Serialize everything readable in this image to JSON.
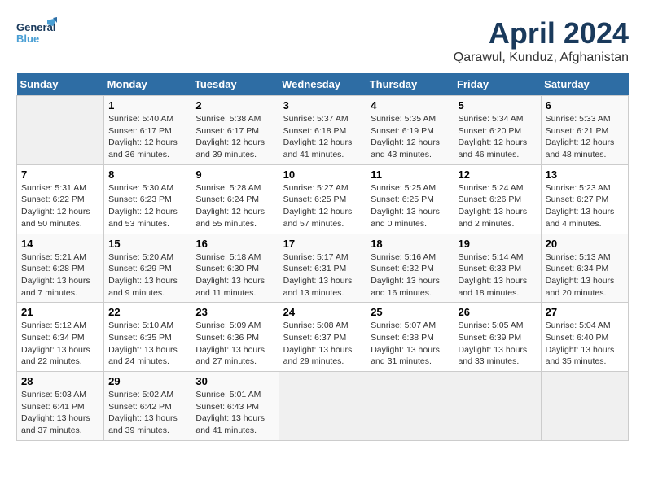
{
  "header": {
    "logo_general": "General",
    "logo_blue": "Blue",
    "month_title": "April 2024",
    "location": "Qarawul, Kunduz, Afghanistan"
  },
  "weekdays": [
    "Sunday",
    "Monday",
    "Tuesday",
    "Wednesday",
    "Thursday",
    "Friday",
    "Saturday"
  ],
  "weeks": [
    [
      {
        "day": "",
        "info": ""
      },
      {
        "day": "1",
        "info": "Sunrise: 5:40 AM\nSunset: 6:17 PM\nDaylight: 12 hours\nand 36 minutes."
      },
      {
        "day": "2",
        "info": "Sunrise: 5:38 AM\nSunset: 6:17 PM\nDaylight: 12 hours\nand 39 minutes."
      },
      {
        "day": "3",
        "info": "Sunrise: 5:37 AM\nSunset: 6:18 PM\nDaylight: 12 hours\nand 41 minutes."
      },
      {
        "day": "4",
        "info": "Sunrise: 5:35 AM\nSunset: 6:19 PM\nDaylight: 12 hours\nand 43 minutes."
      },
      {
        "day": "5",
        "info": "Sunrise: 5:34 AM\nSunset: 6:20 PM\nDaylight: 12 hours\nand 46 minutes."
      },
      {
        "day": "6",
        "info": "Sunrise: 5:33 AM\nSunset: 6:21 PM\nDaylight: 12 hours\nand 48 minutes."
      }
    ],
    [
      {
        "day": "7",
        "info": "Sunrise: 5:31 AM\nSunset: 6:22 PM\nDaylight: 12 hours\nand 50 minutes."
      },
      {
        "day": "8",
        "info": "Sunrise: 5:30 AM\nSunset: 6:23 PM\nDaylight: 12 hours\nand 53 minutes."
      },
      {
        "day": "9",
        "info": "Sunrise: 5:28 AM\nSunset: 6:24 PM\nDaylight: 12 hours\nand 55 minutes."
      },
      {
        "day": "10",
        "info": "Sunrise: 5:27 AM\nSunset: 6:25 PM\nDaylight: 12 hours\nand 57 minutes."
      },
      {
        "day": "11",
        "info": "Sunrise: 5:25 AM\nSunset: 6:25 PM\nDaylight: 13 hours\nand 0 minutes."
      },
      {
        "day": "12",
        "info": "Sunrise: 5:24 AM\nSunset: 6:26 PM\nDaylight: 13 hours\nand 2 minutes."
      },
      {
        "day": "13",
        "info": "Sunrise: 5:23 AM\nSunset: 6:27 PM\nDaylight: 13 hours\nand 4 minutes."
      }
    ],
    [
      {
        "day": "14",
        "info": "Sunrise: 5:21 AM\nSunset: 6:28 PM\nDaylight: 13 hours\nand 7 minutes."
      },
      {
        "day": "15",
        "info": "Sunrise: 5:20 AM\nSunset: 6:29 PM\nDaylight: 13 hours\nand 9 minutes."
      },
      {
        "day": "16",
        "info": "Sunrise: 5:18 AM\nSunset: 6:30 PM\nDaylight: 13 hours\nand 11 minutes."
      },
      {
        "day": "17",
        "info": "Sunrise: 5:17 AM\nSunset: 6:31 PM\nDaylight: 13 hours\nand 13 minutes."
      },
      {
        "day": "18",
        "info": "Sunrise: 5:16 AM\nSunset: 6:32 PM\nDaylight: 13 hours\nand 16 minutes."
      },
      {
        "day": "19",
        "info": "Sunrise: 5:14 AM\nSunset: 6:33 PM\nDaylight: 13 hours\nand 18 minutes."
      },
      {
        "day": "20",
        "info": "Sunrise: 5:13 AM\nSunset: 6:34 PM\nDaylight: 13 hours\nand 20 minutes."
      }
    ],
    [
      {
        "day": "21",
        "info": "Sunrise: 5:12 AM\nSunset: 6:34 PM\nDaylight: 13 hours\nand 22 minutes."
      },
      {
        "day": "22",
        "info": "Sunrise: 5:10 AM\nSunset: 6:35 PM\nDaylight: 13 hours\nand 24 minutes."
      },
      {
        "day": "23",
        "info": "Sunrise: 5:09 AM\nSunset: 6:36 PM\nDaylight: 13 hours\nand 27 minutes."
      },
      {
        "day": "24",
        "info": "Sunrise: 5:08 AM\nSunset: 6:37 PM\nDaylight: 13 hours\nand 29 minutes."
      },
      {
        "day": "25",
        "info": "Sunrise: 5:07 AM\nSunset: 6:38 PM\nDaylight: 13 hours\nand 31 minutes."
      },
      {
        "day": "26",
        "info": "Sunrise: 5:05 AM\nSunset: 6:39 PM\nDaylight: 13 hours\nand 33 minutes."
      },
      {
        "day": "27",
        "info": "Sunrise: 5:04 AM\nSunset: 6:40 PM\nDaylight: 13 hours\nand 35 minutes."
      }
    ],
    [
      {
        "day": "28",
        "info": "Sunrise: 5:03 AM\nSunset: 6:41 PM\nDaylight: 13 hours\nand 37 minutes."
      },
      {
        "day": "29",
        "info": "Sunrise: 5:02 AM\nSunset: 6:42 PM\nDaylight: 13 hours\nand 39 minutes."
      },
      {
        "day": "30",
        "info": "Sunrise: 5:01 AM\nSunset: 6:43 PM\nDaylight: 13 hours\nand 41 minutes."
      },
      {
        "day": "",
        "info": ""
      },
      {
        "day": "",
        "info": ""
      },
      {
        "day": "",
        "info": ""
      },
      {
        "day": "",
        "info": ""
      }
    ]
  ]
}
